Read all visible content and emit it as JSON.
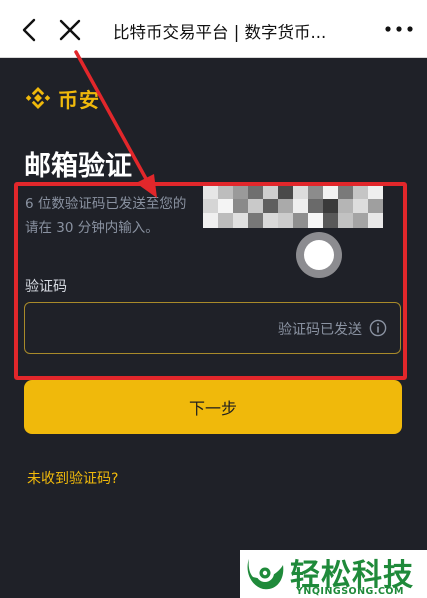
{
  "browser": {
    "title": "比特币交易平台 | 数字货币...",
    "back_icon": "chevron-left-icon",
    "close_icon": "close-icon",
    "more_icon": "more-dots-icon"
  },
  "brand": {
    "name": "币安",
    "accent_color": "#f0b90b",
    "logo_icon": "binance-logo-icon"
  },
  "page": {
    "heading": "邮箱验证",
    "description_line1": "6 位数验证码已发送至您的",
    "description_line2": "请在 30 分钟内输入。"
  },
  "form": {
    "code_label": "验证码",
    "code_value": "",
    "code_status": "验证码已发送",
    "info_icon": "info-icon",
    "submit_label": "下一步",
    "resend_link": "未收到验证码?"
  },
  "annotations": {
    "highlight_color": "#e2272b",
    "arrow_icon": "arrow-annotation-icon",
    "touch_indicator": "touch-point-icon"
  },
  "watermark": {
    "text": "轻松科技",
    "domain": "YNQINGSONG.COM",
    "color": "#1f8a3a"
  }
}
